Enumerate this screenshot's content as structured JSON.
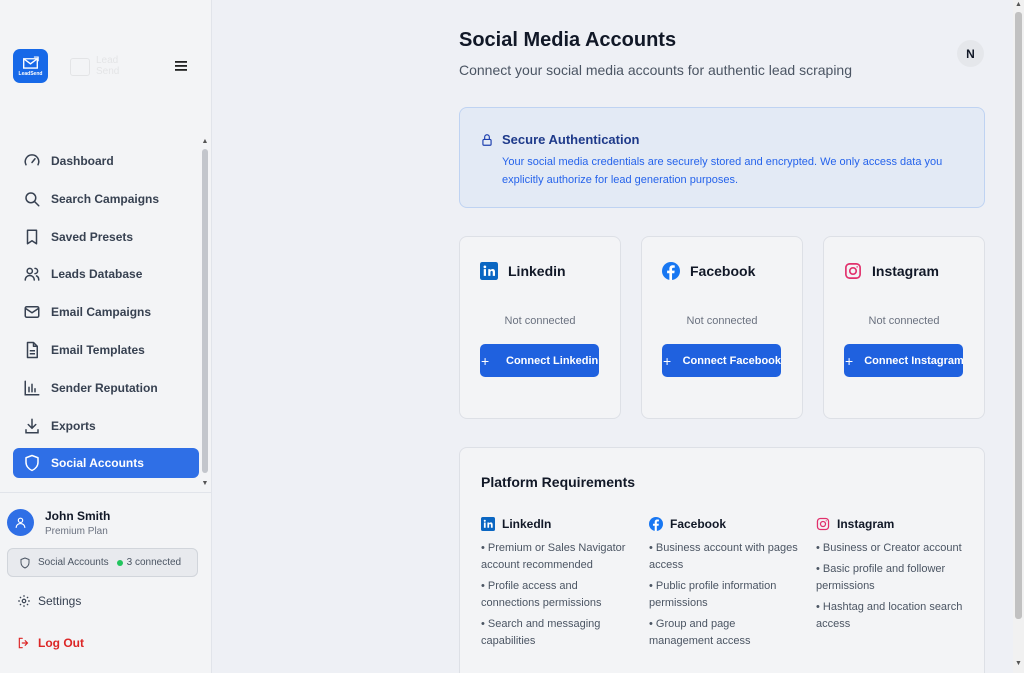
{
  "brand": {
    "logo_text": "LeadSend",
    "ghost_line1": "Lead",
    "ghost_line2": "Send"
  },
  "sidebar": {
    "items": [
      {
        "label": "Dashboard",
        "icon": "gauge-icon"
      },
      {
        "label": "Search Campaigns",
        "icon": "search-icon"
      },
      {
        "label": "Saved Presets",
        "icon": "bookmark-icon"
      },
      {
        "label": "Leads Database",
        "icon": "users-icon"
      },
      {
        "label": "Email Campaigns",
        "icon": "mail-icon"
      },
      {
        "label": "Email Templates",
        "icon": "file-text-icon"
      },
      {
        "label": "Sender Reputation",
        "icon": "bar-chart-icon"
      },
      {
        "label": "Exports",
        "icon": "download-icon"
      },
      {
        "label": "Social Accounts",
        "icon": "shield-icon",
        "active": true
      }
    ]
  },
  "user": {
    "name": "John Smith",
    "plan": "Premium Plan",
    "social_label": "Social Accounts",
    "social_count": "3 connected",
    "settings_label": "Settings",
    "logout_label": "Log Out"
  },
  "header": {
    "title": "Social Media Accounts",
    "subtitle": "Connect your social media accounts for authentic lead scraping",
    "avatar_initial": "N"
  },
  "notice": {
    "title": "Secure Authentication",
    "body": "Your social media credentials are securely stored and encrypted. We only access data you explicitly authorize for lead generation purposes."
  },
  "cards": [
    {
      "name": "Linkedin",
      "status": "Not connected",
      "button": "Connect Linkedin"
    },
    {
      "name": "Facebook",
      "status": "Not connected",
      "button": "Connect Facebook"
    },
    {
      "name": "Instagram",
      "status": "Not connected",
      "button": "Connect Instagram"
    }
  ],
  "requirements": {
    "title": "Platform Requirements",
    "columns": [
      {
        "name": "LinkedIn",
        "items": [
          "• Premium or Sales Navigator account recommended",
          "• Profile access and connections permissions",
          "• Search and messaging capabilities"
        ]
      },
      {
        "name": "Facebook",
        "items": [
          "• Business account with pages access",
          "• Public profile information permissions",
          "• Group and page management access"
        ]
      },
      {
        "name": "Instagram",
        "items": [
          "• Business or Creator account",
          "• Basic profile and follower permissions",
          "• Hashtag and location search access"
        ]
      }
    ]
  },
  "colors": {
    "accent": "#2f6fe6",
    "linkedin": "#0a66c2",
    "facebook": "#1877f2",
    "instagram": "#e1306c",
    "danger": "#dc2626",
    "success": "#22c55e"
  }
}
